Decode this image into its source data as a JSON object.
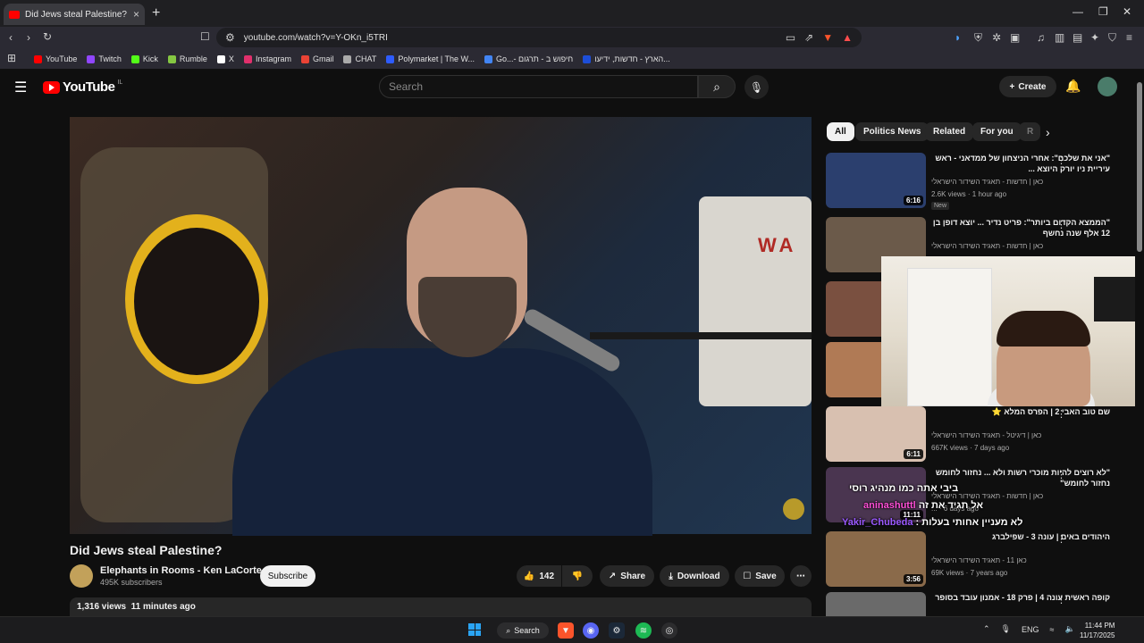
{
  "browser": {
    "tab_title": "Did Jews steal Palestine? - YouTube",
    "url": "youtube.com/watch?v=Y-OKn_i5TRI",
    "bookmarks": [
      {
        "label": "YouTube",
        "color": "#ff0000"
      },
      {
        "label": "Twitch",
        "color": "#9146ff"
      },
      {
        "label": "Kick",
        "color": "#53fc18"
      },
      {
        "label": "Rumble",
        "color": "#85c742"
      },
      {
        "label": "X",
        "color": "#ffffff"
      },
      {
        "label": "Instagram",
        "color": "#e1306c"
      },
      {
        "label": "Gmail",
        "color": "#ea4335"
      },
      {
        "label": "CHAT",
        "color": "#aaaaaa"
      },
      {
        "label": "Polymarket | The W...",
        "color": "#2e5cff"
      },
      {
        "label": "Go...- חיפוש ב - תרגום",
        "color": "#4285f4"
      },
      {
        "label": "הארץ - חדשות, ידיעו...",
        "color": "#1d4ed8"
      }
    ]
  },
  "youtube": {
    "logo": "YouTube",
    "country": "IL",
    "search_placeholder": "Search",
    "create_label": "Create"
  },
  "video": {
    "title": "Did Jews steal Palestine?",
    "channel": "Elephants in Rooms - Ken LaCorte",
    "subscribers": "495K subscribers",
    "subscribe_label": "Subscribe",
    "likes": "142",
    "share_label": "Share",
    "download_label": "Download",
    "save_label": "Save",
    "views": "1,316 views",
    "age": "11 minutes ago",
    "sign_text": "WA"
  },
  "chips": [
    "All",
    "Politics News",
    "Related",
    "For you",
    "R"
  ],
  "recs": [
    {
      "title": "\"אני את שלכם\": אחרי הניצחון של ממדאני - ראש עיריית ניו יורק היוצא ...",
      "channel": "כאן | חדשות - תאגיד השידור הישראלי",
      "meta": "2.6K views · 1 hour ago",
      "badge": "New",
      "duration": "6:16"
    },
    {
      "title": "\"הממצא הקדום ביותר\": פריט נדיר ... יוצא דופן בן 12 אלף שנה נחשף",
      "channel": "כאן | חדשות - תאגיד השידור הישראלי",
      "meta": "",
      "badge": "",
      "duration": ""
    },
    {
      "title": "",
      "channel": "",
      "meta": "",
      "badge": "",
      "duration": ""
    },
    {
      "title": "",
      "channel": "",
      "meta": "",
      "badge": "",
      "duration": ""
    },
    {
      "title": "שם טוב האבי 2 | הפרס המלא ⭐",
      "channel": "כאן | דיגיטל - תאגיד השידור הישראלי",
      "meta": "667K views · 7 days ago",
      "badge": "",
      "duration": "6:11"
    },
    {
      "title": "\"לא רוצים להיות מוכרי רשות ולא ... נחזור לחומש נחזור לחומש\"",
      "channel": "כאן | חדשות - תאגיד השידור הישראלי",
      "meta": "... · 6 days ago",
      "badge": "",
      "duration": "11:11"
    },
    {
      "title": "היהודים באים | עונה 3 - שפילברג",
      "channel": "כאן 11 - תאגיד השידור הישראלי",
      "meta": "69K views · 7 years ago",
      "badge": "",
      "duration": "3:56"
    },
    {
      "title": "קופה ראשית עונה 4 | פרק 18 - אמנון עובד בסופר",
      "channel": "",
      "meta": "",
      "badge": "",
      "duration": ""
    }
  ],
  "chat": [
    {
      "user": "",
      "msg": "ביבי אתה כמו מנהיג רוסי",
      "color": "#ffffff"
    },
    {
      "user": "Yakir_Chubeda",
      "msg": "לא מעניין אחותי בעלות",
      "color": "#9b59ff"
    },
    {
      "user": "aninashuttl",
      "msg": "אל תגיד את זה",
      "color": "#ff4fd8"
    }
  ],
  "taskbar": {
    "search_label": "Search",
    "lang": "ENG",
    "time": "11:44 PM",
    "date": "11/17/2025"
  }
}
